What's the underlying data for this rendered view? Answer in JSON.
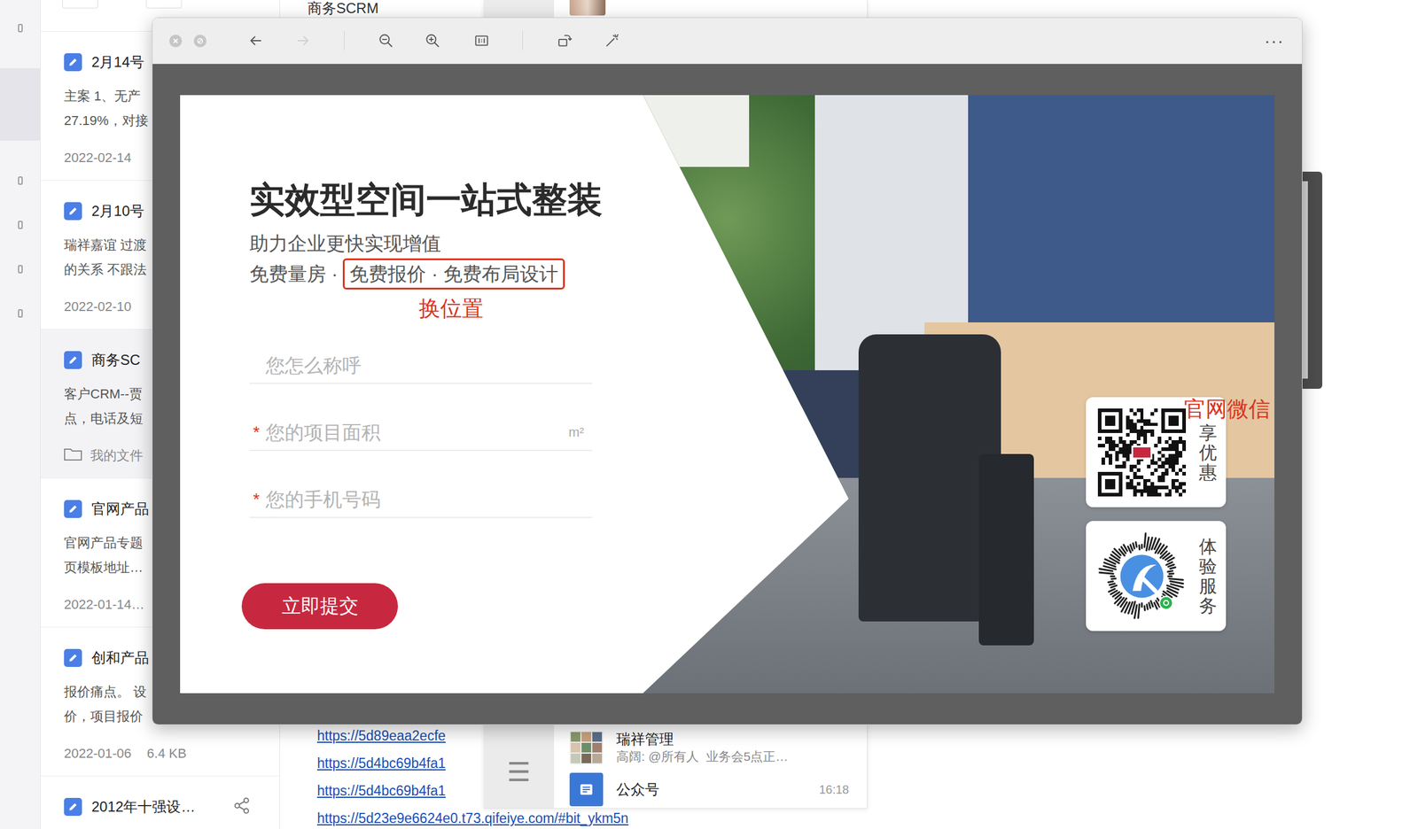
{
  "notes_app": {
    "header_title": "商务SCRM",
    "notes": [
      {
        "title": "2月14号",
        "lines": [
          "主案 1、无产",
          "27.19%，对接"
        ],
        "date": "2022-02-14",
        "selected": false,
        "shared": false
      },
      {
        "title": "2月10号",
        "lines": [
          "瑞祥嘉谊 过渡",
          "的关系 不跟法"
        ],
        "date": "2022-02-10",
        "selected": false,
        "shared": false
      },
      {
        "title": "商务SC",
        "lines": [
          "客户CRM--贾",
          "点，电话及短"
        ],
        "folder": "我的文件",
        "selected": true,
        "shared": false
      },
      {
        "title": "官网产品",
        "lines": [
          "官网产品专题",
          "页模板地址…"
        ],
        "date": "2022-01-14…",
        "selected": false,
        "shared": false
      },
      {
        "title": "创和产品",
        "lines": [
          "报价痛点。 设",
          "价，项目报价"
        ],
        "date": "2022-01-06",
        "size": "6.4 KB",
        "selected": false,
        "shared": false
      },
      {
        "title": "2012年十强设…",
        "selected": false,
        "shared": true
      }
    ],
    "links": [
      "https://5d89eaa2ecfe",
      "https://5d4bc69b4fa1",
      "https://5d4bc69b4fa1",
      "https://5d23e9e6624e0.t73.qifeiye.com/#bit_ykm5n"
    ]
  },
  "chat_app": {
    "menu_icon": "☰",
    "conversations": [
      {
        "name": "瑞祥管理",
        "preview": "高阔: @所有人  业务会5点正…",
        "kind": "group"
      },
      {
        "name": "公众号",
        "time": "16:18",
        "kind": "official"
      }
    ]
  },
  "viewer": {
    "more_icon": "···",
    "forward_disabled": true,
    "banner": {
      "title": "实效型空间一站式整装",
      "subtitle": "助力企业更快实现增值",
      "offer_plain": "免费量房 · ",
      "offer_boxed": "免费报价 · 免费布局设计",
      "required_mark": "*",
      "fields": [
        {
          "placeholder": "您怎么称呼",
          "required": false
        },
        {
          "placeholder": "您的项目面积",
          "required": true,
          "unit": "m²"
        },
        {
          "placeholder": "您的手机号码",
          "required": true
        }
      ],
      "submit": "立即提交",
      "qr_cards": [
        {
          "label": "享优惠",
          "kind": "qr"
        },
        {
          "label": "体验服务",
          "kind": "miniprogram"
        }
      ]
    },
    "annotations": {
      "move_note": "换位置",
      "qr_note": "官网微信"
    }
  }
}
